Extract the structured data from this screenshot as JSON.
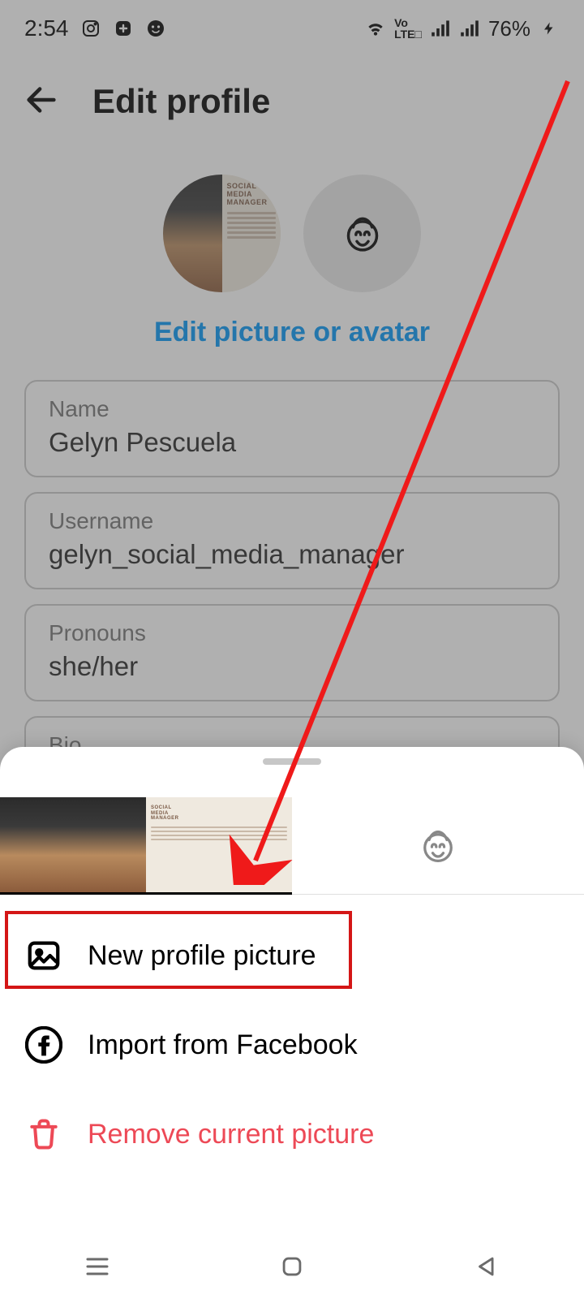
{
  "status": {
    "time": "2:54",
    "battery": "76%"
  },
  "header": {
    "title": "Edit profile"
  },
  "profile": {
    "edit_link": "Edit picture or avatar"
  },
  "fields": {
    "name": {
      "label": "Name",
      "value": "Gelyn Pescuela"
    },
    "username": {
      "label": "Username",
      "value": "gelyn_social_media_manager"
    },
    "pronouns": {
      "label": "Pronouns",
      "value": "she/her"
    },
    "bio": {
      "label": "Bio",
      "value": ""
    }
  },
  "sheet": {
    "options": {
      "new_picture": "New profile picture",
      "import_fb": "Import from Facebook",
      "remove": "Remove current picture"
    }
  },
  "avatar_card": {
    "line1": "SOCIAL",
    "line2": "MEDIA",
    "line3": "MANAGER"
  },
  "colors": {
    "accent": "#0095f6",
    "danger": "#ed4956",
    "annotation": "#d41616"
  }
}
